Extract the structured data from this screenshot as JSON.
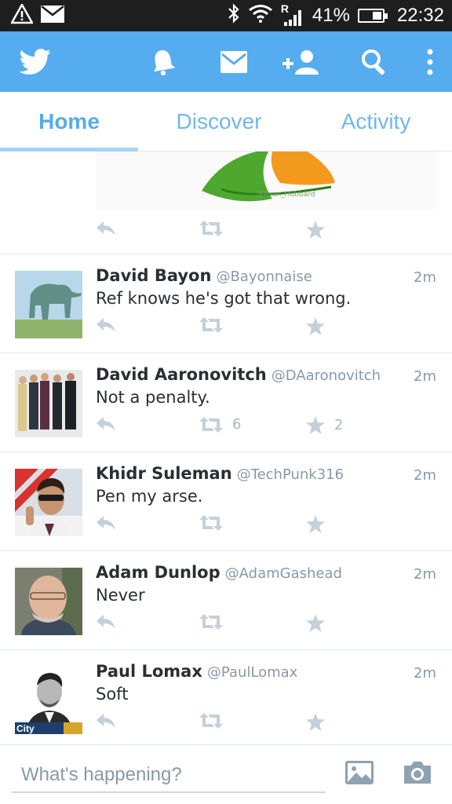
{
  "status_bar": {
    "battery_percent": "41%",
    "time": "22:32",
    "signal_roaming_label": "R"
  },
  "tabs": [
    {
      "label": "Home"
    },
    {
      "label": "Discover"
    },
    {
      "label": "Activity"
    }
  ],
  "tweets": [
    {
      "name": "David Bayon",
      "handle": "@Bayonnaise",
      "time": "2m",
      "text": "Ref knows he's got that wrong.",
      "retweets": "",
      "favorites": ""
    },
    {
      "name": "David Aaronovitch",
      "handle": "@DAaronovitch",
      "time": "2m",
      "text": "Not a penalty.",
      "retweets": "6",
      "favorites": "2"
    },
    {
      "name": "Khidr Suleman",
      "handle": "@TechPunk316",
      "time": "2m",
      "text": "Pen my arse.",
      "retweets": "",
      "favorites": ""
    },
    {
      "name": "Adam Dunlop",
      "handle": "@AdamGashead",
      "time": "2m",
      "text": "Never",
      "retweets": "",
      "favorites": ""
    },
    {
      "name": "Paul Lomax",
      "handle": "@PaulLomax",
      "time": "2m",
      "text": "Soft",
      "retweets": "",
      "favorites": "",
      "avatar_caption": "City"
    }
  ],
  "partial_image_watermark": "@Ryan_Hubbard",
  "composer": {
    "placeholder": "What's happening?"
  }
}
